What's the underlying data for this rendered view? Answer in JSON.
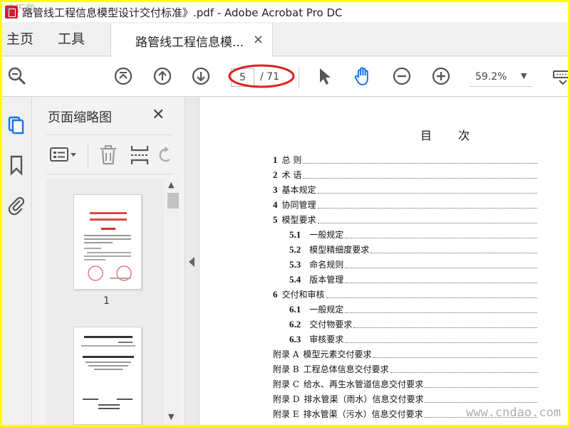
{
  "window": {
    "title": "路管线工程信息模型设计交付标准》.pdf - Adobe Acrobat Pro DC"
  },
  "tabs": {
    "home": "主页",
    "tools": "工具",
    "document": "路管线工程信息模...",
    "close": "×"
  },
  "toolbar": {
    "current_page": "5",
    "total_pages": "/ 71",
    "zoom": "59.2%"
  },
  "thumbnails": {
    "title": "页面缩略图",
    "close": "✕",
    "pages": [
      "1"
    ]
  },
  "document": {
    "heading": "目 次",
    "toc": [
      {
        "num": "1",
        "label": "总 则",
        "level": 1
      },
      {
        "num": "2",
        "label": "术 语",
        "level": 1
      },
      {
        "num": "3",
        "label": "基本规定",
        "level": 1
      },
      {
        "num": "4",
        "label": "协同管理",
        "level": 1
      },
      {
        "num": "5",
        "label": "模型要求",
        "level": 1
      },
      {
        "num": "5.1",
        "label": "一般规定",
        "level": 2
      },
      {
        "num": "5.2",
        "label": "模型精细度要求",
        "level": 2
      },
      {
        "num": "5.3",
        "label": "命名规则",
        "level": 2
      },
      {
        "num": "5.4",
        "label": "版本管理",
        "level": 2
      },
      {
        "num": "6",
        "label": "交付和审核",
        "level": 1
      },
      {
        "num": "6.1",
        "label": "一般规定",
        "level": 2
      },
      {
        "num": "6.2",
        "label": "交付物要求",
        "level": 2
      },
      {
        "num": "6.3",
        "label": "审核要求",
        "level": 2
      },
      {
        "num": "附录 A",
        "label": "模型元素交付要求",
        "level": 0
      },
      {
        "num": "附录 B",
        "label": "工程总体信息交付要求",
        "level": 0
      },
      {
        "num": "附录 C",
        "label": "给水、再生水管道信息交付要求",
        "level": 0
      },
      {
        "num": "附录 D",
        "label": "排水管渠（雨水）信息交付要求",
        "level": 0
      },
      {
        "num": "附录 E",
        "label": "排水管渠（污水）信息交付要求",
        "level": 0
      }
    ]
  },
  "watermarks": {
    "top_left": "安下载",
    "bottom_right": "www.cndao.com"
  },
  "colors": {
    "border": "#ffff00",
    "annotation": "#e02020",
    "active_tool": "#1473e6"
  }
}
